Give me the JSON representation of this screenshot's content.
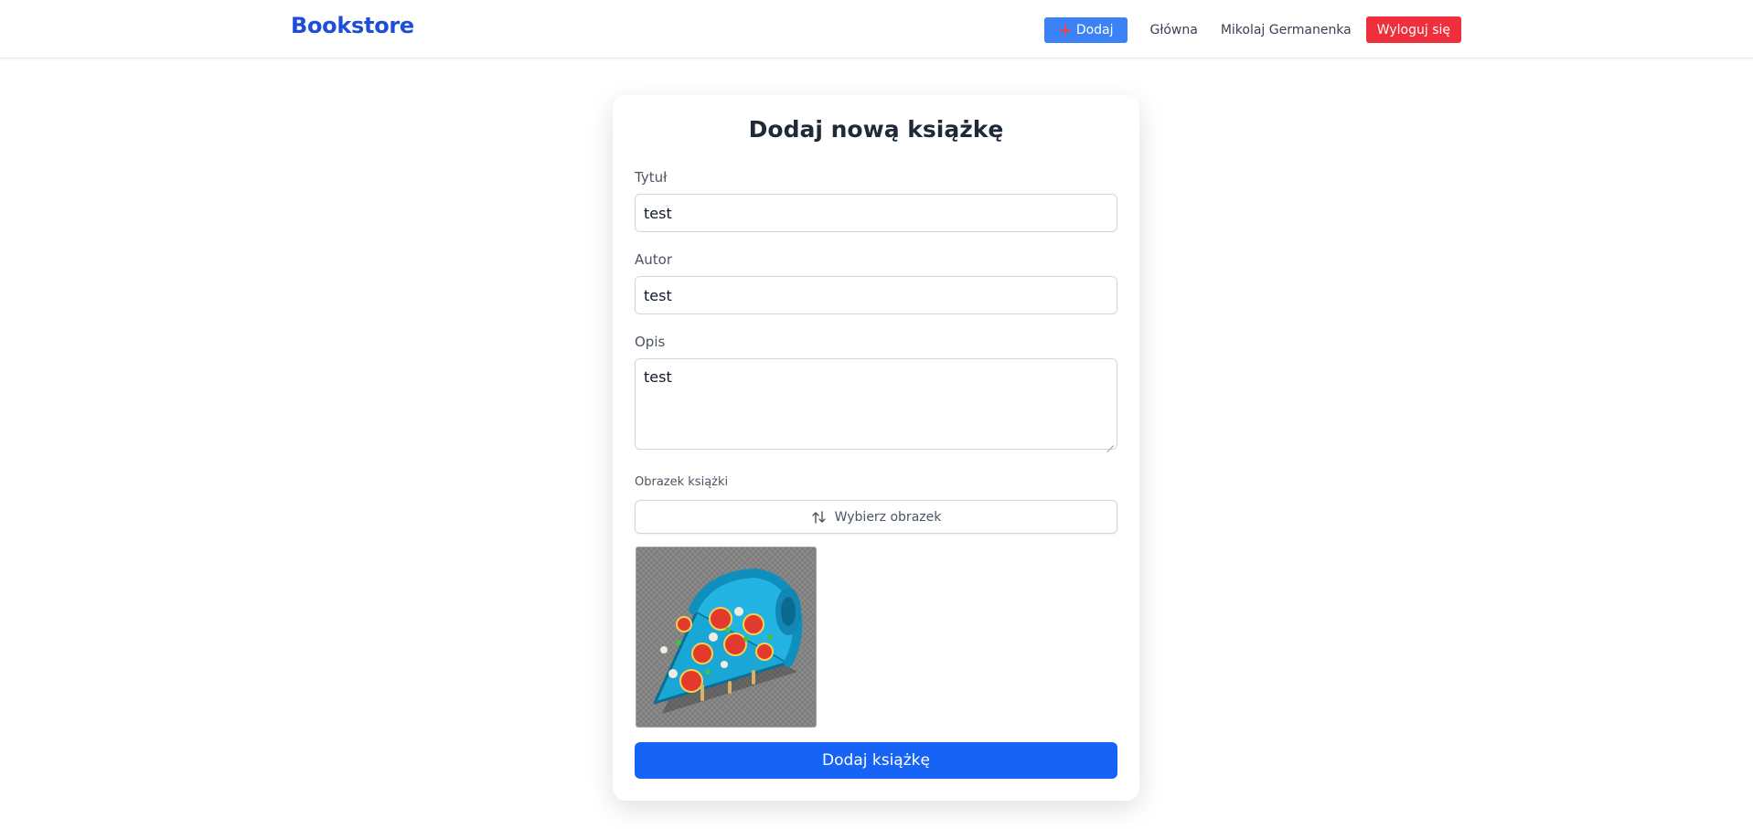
{
  "navbar": {
    "brand": "Bookstore",
    "add_label": "Dodaj",
    "home_label": "Główna",
    "user_name": "Mikolaj Germanenka",
    "logout_label": "Wyloguj się"
  },
  "form": {
    "title": "Dodaj nową książkę",
    "title_field": {
      "label": "Tytuł",
      "value": "test"
    },
    "author_field": {
      "label": "Autor",
      "value": "test"
    },
    "description_field": {
      "label": "Opis",
      "value": "test"
    },
    "image_field": {
      "label": "Obrazek książki",
      "button_label": "Wybierz obrazek"
    },
    "submit_label": "Dodaj książkę"
  },
  "colors": {
    "brand": "#1d4ed8",
    "add_button": "#3b82f6",
    "logout_button": "#ef2f3c",
    "submit_button": "#1663f5"
  },
  "icons": {
    "add": "plus-icon",
    "file_picker": "swap-arrows-icon",
    "preview": "pizza-slice-image"
  }
}
